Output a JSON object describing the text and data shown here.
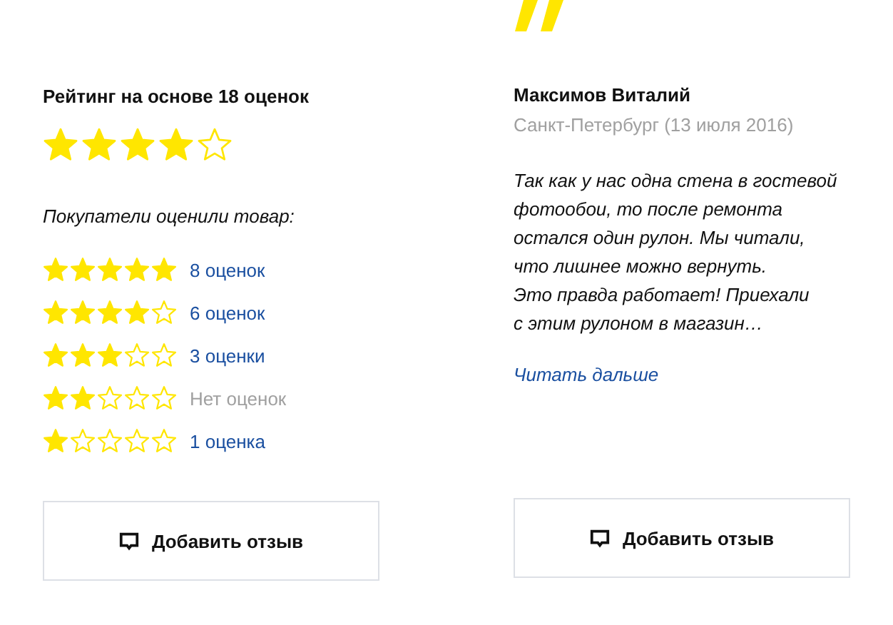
{
  "rating": {
    "title": "Рейтинг на основе 18 оценок",
    "stars": 4,
    "subtitle": "Покупатели оценили товар:",
    "breakdown": [
      {
        "stars": 5,
        "count": "8 оценок",
        "disabled": false
      },
      {
        "stars": 4,
        "count": "6 оценок",
        "disabled": false
      },
      {
        "stars": 3,
        "count": "3 оценки",
        "disabled": false
      },
      {
        "stars": 2,
        "count": "Нет оценок",
        "disabled": true
      },
      {
        "stars": 1,
        "count": "1 оценка",
        "disabled": false
      }
    ],
    "button": "Добавить отзыв"
  },
  "review": {
    "author": "Максимов Виталий",
    "meta": "Санкт-Петербург (13 июля 2016)",
    "lines": [
      "Так как у нас одна стена в гостевой",
      "фотообои, то после ремонта",
      "остался один рулон. Мы читали,",
      "что лишнее можно вернуть.",
      "Это правда работает! Приехали",
      "с этим рулоном в магазин…"
    ],
    "link": "Читать дальше",
    "button": "Добавить отзыв"
  }
}
